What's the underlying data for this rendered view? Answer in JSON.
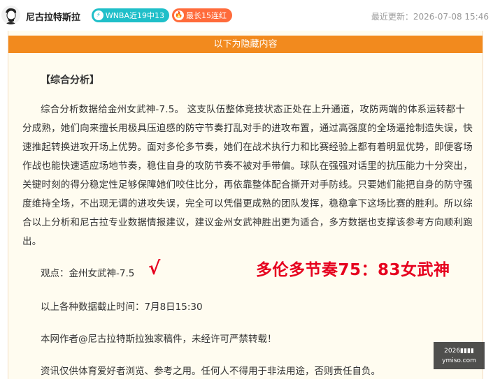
{
  "header": {
    "author": "尼古拉特斯拉",
    "badges": [
      {
        "icon": "lightning-icon",
        "label": "WNBA近19中13",
        "color": "#1fbfc9"
      },
      {
        "icon": "fire-icon",
        "label": "最长15连红",
        "color": "#ff6b3b"
      }
    ],
    "update_time": "最近更新：2026-07-08 15:46"
  },
  "banner": {
    "label": "以下为隐藏内容",
    "color": "#f28a1e"
  },
  "content": {
    "section_title": "【综合分析】",
    "paragraph": "综合分析数据给金州女武神-7.5。 这支队伍整体竞技状态正处在上升通道，攻防两端的体系运转都十分成熟，她们向来擅长用极具压迫感的防守节奏打乱对手的进攻布置，通过高强度的全场逼抢制造失误，快速推起转换进攻开场上优势。面对多伦多节奏，她们在战术执行力和比赛经验上都有着明显优势，即便客场作战也能快速适应场地节奏，稳住自身的攻防节奏不被对手带偏。球队在强强对话里的抗压能力十分突出，关键时刻的得分稳定性足够保障她们咬住比分，再依靠整体配合撕开对手防线。只要她们能把自身的防守强度维持全场，不出现无谓的进攻失误，完全可以凭借更成熟的团队发挥，稳稳拿下这场比赛的胜利。所以综合以上分析和尼古拉专业数据情报建议，建议金州女武神胜出更为适合，多方数据也支撑该参考方向顺利跑出。",
    "viewpoint": "观点：金州女武神-7.5",
    "check_mark": "√",
    "final_score": "多伦多节奏75：83女武神",
    "cutoff": "以上各种数据截止时间：7月8日15:30",
    "copyright": "本网作者@尼古拉特斯拉独家稿件，未经许可严禁转载！",
    "disclaimer": "资讯仅供体育爱好者浏览、参考之用。任何人不得用于非法用途，否则责任自负。"
  },
  "watermark": {
    "line1": "2026▮▮▮▮",
    "line2": "ymiso.com"
  },
  "colors": {
    "accent": "#f28a1e",
    "highlight": "#e6001e"
  }
}
